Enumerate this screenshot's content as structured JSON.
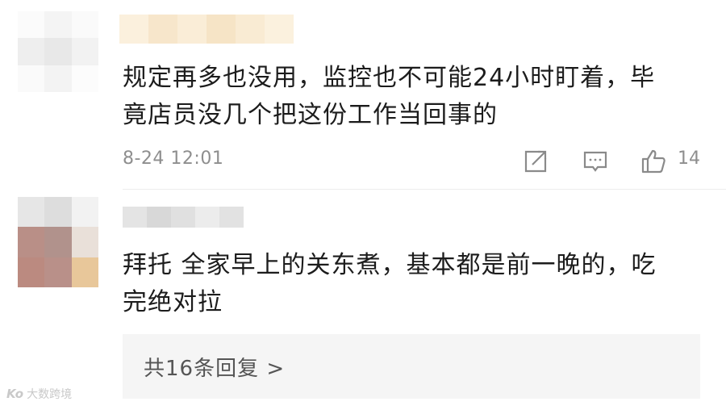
{
  "comments": [
    {
      "text_lines": [
        "规定再多也没用，监控也不可能24小时盯着，毕",
        "竟店员没几个把这份工作当回事的"
      ],
      "time": "8-24 12:01",
      "likes": "14"
    },
    {
      "text_lines": [
        "拜托 全家早上的关东煮，基本都是前一晚的，吃",
        "完绝对拉"
      ],
      "replies_label": "共16条回复 >"
    }
  ],
  "watermark": {
    "logo": "Ko",
    "text": "大数跨境"
  },
  "icons": {
    "share": "share-icon",
    "comment": "comment-icon",
    "like": "thumbs-up-icon"
  },
  "colors": {
    "meta_gray": "#8e8e8e",
    "reply_box_bg": "#f5f5f5",
    "text": "#1c1c1c"
  }
}
